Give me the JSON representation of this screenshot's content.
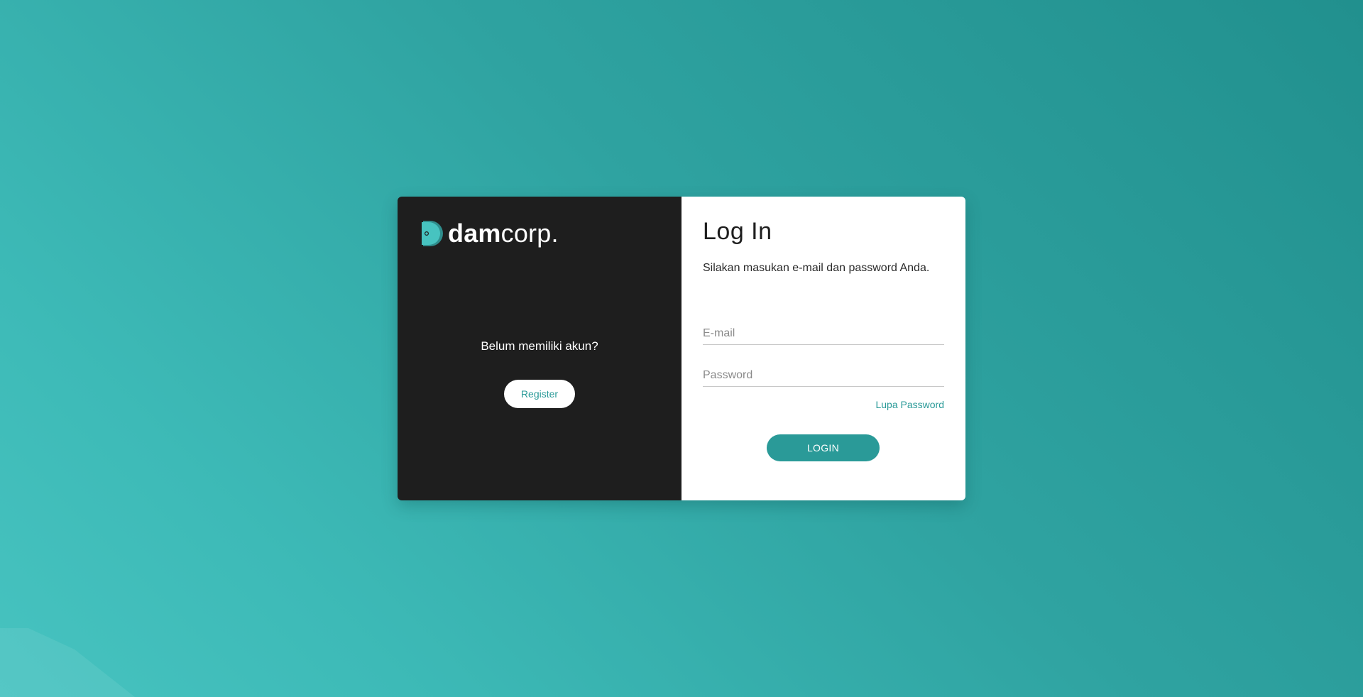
{
  "brand": {
    "name_bold": "dam",
    "name_light": "corp.",
    "logo_icon": "damcorp-logo-icon"
  },
  "register_panel": {
    "prompt": "Belum memiliki akun?",
    "register_label": "Register"
  },
  "login_panel": {
    "title": "Log In",
    "subtitle": "Silakan masukan e-mail dan password Anda.",
    "email_placeholder": "E-mail",
    "email_value": "",
    "password_placeholder": "Password",
    "password_value": "",
    "forgot_label": "Lupa Password",
    "login_label": "LOGIN"
  },
  "colors": {
    "accent": "#2a9a98",
    "background_light": "#47c3c0",
    "background_dark": "#21908e",
    "left_panel": "#1e1e1e",
    "right_panel": "#ffffff"
  }
}
